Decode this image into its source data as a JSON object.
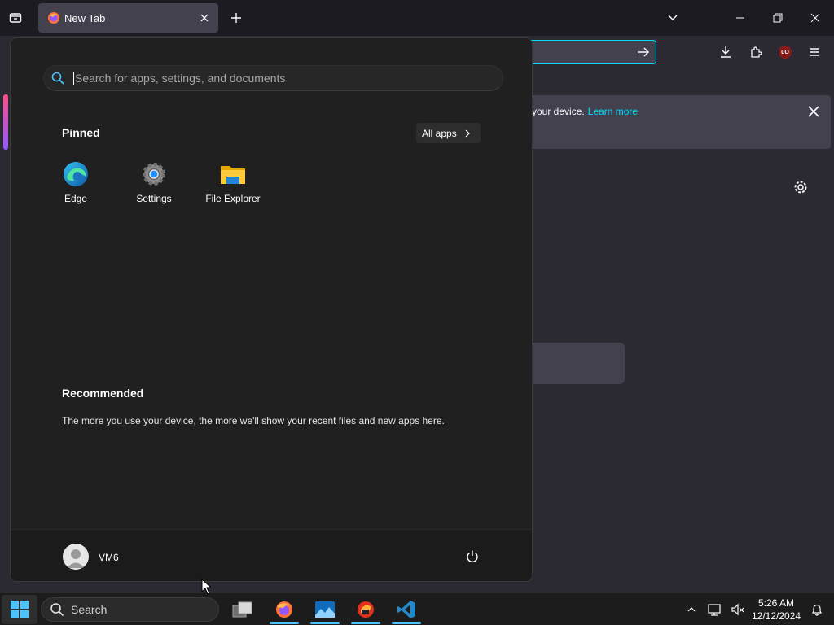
{
  "browser": {
    "tab_title": "New Tab",
    "notice_text": "your device.",
    "notice_link": "Learn more",
    "ublock_label": "uO"
  },
  "start_menu": {
    "search_placeholder": "Search for apps, settings, and documents",
    "pinned_title": "Pinned",
    "all_apps_label": "All apps",
    "pinned_apps": [
      {
        "label": "Edge",
        "icon": "edge-icon"
      },
      {
        "label": "Settings",
        "icon": "settings-gear-icon"
      },
      {
        "label": "File Explorer",
        "icon": "folder-icon"
      }
    ],
    "recommended_title": "Recommended",
    "recommended_text": "The more you use your device, the more we'll show your recent files and new apps here.",
    "user_name": "VM6"
  },
  "taskbar": {
    "search_label": "Search",
    "apps": [
      "task-view-icon",
      "firefox-icon",
      "photos-icon",
      "thunderbird-icon",
      "vscode-icon"
    ],
    "time": "5:26 AM",
    "date": "12/12/2024"
  },
  "colors": {
    "accent": "#4cc2ff",
    "link": "#00ddff",
    "menu_bg": "#202020"
  }
}
